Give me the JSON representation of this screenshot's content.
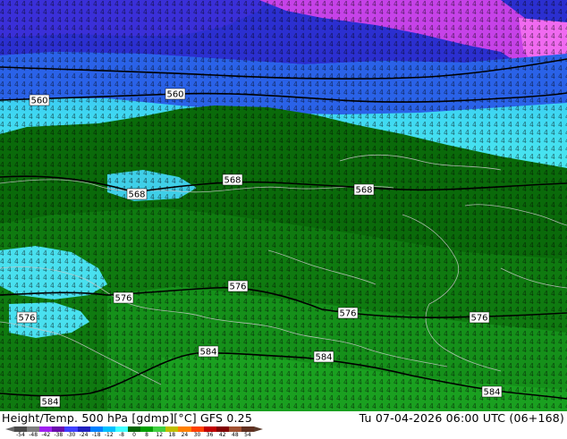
{
  "map": {
    "contour_labels": [
      {
        "value": "560"
      },
      {
        "value": "560"
      },
      {
        "value": "568"
      },
      {
        "value": "568"
      },
      {
        "value": "568"
      },
      {
        "value": "576"
      },
      {
        "value": "576"
      },
      {
        "value": "576"
      },
      {
        "value": "576"
      },
      {
        "value": "576"
      },
      {
        "value": "584"
      },
      {
        "value": "584"
      },
      {
        "value": "584"
      },
      {
        "value": "584"
      }
    ]
  },
  "footer": {
    "title_left": "Height/Temp. 500 hPa [gdmp][°C] GFS 0.25",
    "title_right": "Tu 07-04-2026 06:00 UTC (06+168)"
  },
  "legend": {
    "tick_labels": [
      "-54",
      "-48",
      "-42",
      "-38",
      "-30",
      "-24",
      "-18",
      "-12",
      "-8",
      "0",
      "8",
      "12",
      "18",
      "24",
      "30",
      "36",
      "42",
      "48",
      "54"
    ],
    "colors": [
      "#4a4a4a",
      "#7f7f7f",
      "#a020f0",
      "#6a0dad",
      "#4040ff",
      "#2020c0",
      "#0080ff",
      "#00c0ff",
      "#40ffff",
      "#006400",
      "#00a000",
      "#40d040",
      "#c0c000",
      "#ff8000",
      "#ff4000",
      "#c00000",
      "#800000",
      "#a05030",
      "#603020"
    ]
  }
}
